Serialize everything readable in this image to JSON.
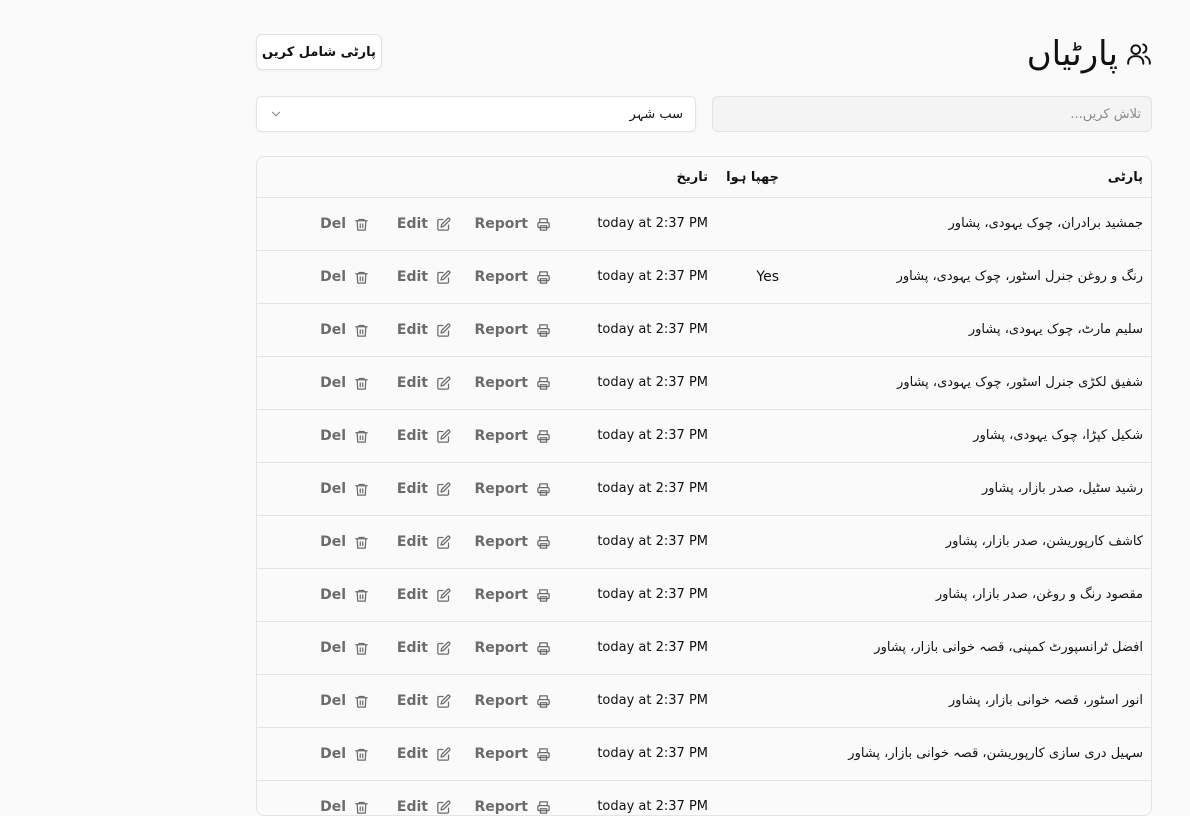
{
  "header": {
    "title": "پارٹیاں",
    "title_icon": "users-icon",
    "add_button": "پارٹی شامل کریں"
  },
  "filters": {
    "search_placeholder": "تلاش کریں...",
    "search_value": "",
    "city_selected": "سب شہر"
  },
  "table": {
    "columns": {
      "party": "پارٹی",
      "printed": "چھپا ہوا",
      "date": "تاریخ"
    },
    "actions": {
      "report": "Report",
      "report_icon": "printer-icon",
      "edit": "Edit",
      "edit_icon": "edit-icon",
      "del": "Del",
      "del_icon": "trash-icon"
    },
    "rows": [
      {
        "party": "جمشید برادران، چوک یہودی، پشاور",
        "printed": "",
        "date": "today at 2:37 PM"
      },
      {
        "party": "رنگ و روغن جنرل اسٹور، چوک یہودی، پشاور",
        "printed": "Yes",
        "date": "today at 2:37 PM"
      },
      {
        "party": "سلیم مارٹ، چوک یہودی، پشاور",
        "printed": "",
        "date": "today at 2:37 PM"
      },
      {
        "party": "شفیق لکڑی جنرل اسٹور، چوک یہودی، پشاور",
        "printed": "",
        "date": "today at 2:37 PM"
      },
      {
        "party": "شکیل کپڑا، چوک یہودی، پشاور",
        "printed": "",
        "date": "today at 2:37 PM"
      },
      {
        "party": "رشید سٹیل، صدر بازار، پشاور",
        "printed": "",
        "date": "today at 2:37 PM"
      },
      {
        "party": "کاشف کارپوریشن، صدر بازار، پشاور",
        "printed": "",
        "date": "today at 2:37 PM"
      },
      {
        "party": "مقصود رنگ و روغن، صدر بازار، پشاور",
        "printed": "",
        "date": "today at 2:37 PM"
      },
      {
        "party": "افضل ٹرانسپورٹ کمپنی، قصہ خوانی بازار، پشاور",
        "printed": "",
        "date": "today at 2:37 PM"
      },
      {
        "party": "انور اسٹور، قصہ خوانی بازار، پشاور",
        "printed": "",
        "date": "today at 2:37 PM"
      },
      {
        "party": "سہیل دری سازی کارپوریشن، قصہ خوانی بازار، پشاور",
        "printed": "",
        "date": "today at 2:37 PM"
      },
      {
        "party": "",
        "printed": "",
        "date": "today at 2:37 PM"
      }
    ]
  }
}
